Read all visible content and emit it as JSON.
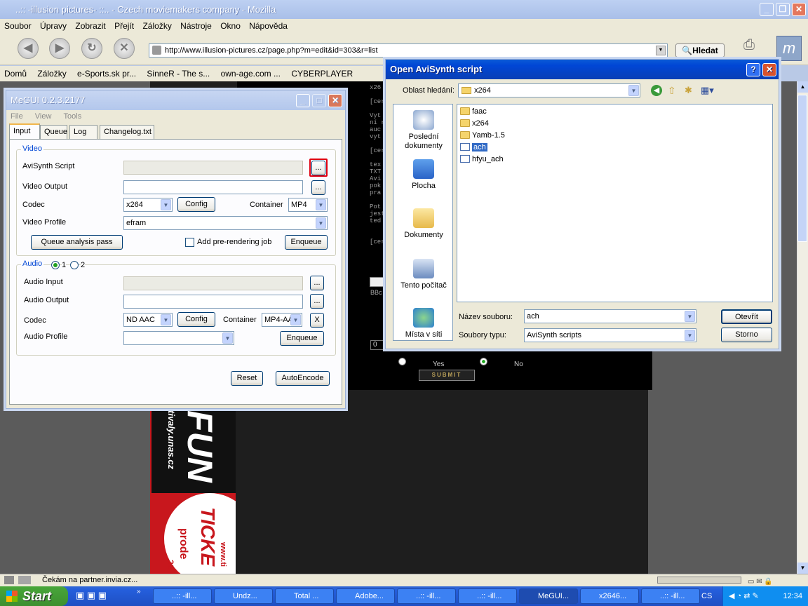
{
  "browser": {
    "title": "..:: -illusion pictures- ::.. - Czech moviemakers company - Mozilla",
    "menu": [
      "Soubor",
      "Úpravy",
      "Zobrazit",
      "Přejít",
      "Záložky",
      "Nástroje",
      "Okno",
      "Nápověda"
    ],
    "url": "http://www.illusion-pictures.cz/page.php?m=edit&id=303&r=list",
    "search_label": "Hledat",
    "bookmarks": [
      "Domů",
      "Záložky",
      "e-Sports.sk pr...",
      "SinneR - The s...",
      "own-age.com ...",
      "CYBERPLAYER"
    ],
    "status": "Čekám na partner.invia.cz...",
    "page_yes": "Yes",
    "page_no": "No",
    "page_submit": "SUBMIT",
    "terminal_lines": [
      "x26",
      "",
      "[cer",
      "",
      "Vyt",
      "ní r",
      "auc",
      "vyt",
      "",
      "[cer",
      "",
      "tex",
      "TXT",
      "Avi",
      "pok",
      "pra",
      "",
      "Pot",
      "jest",
      "ted",
      "",
      "",
      "[cer"
    ],
    "banner_text": "FUN",
    "banner_url": "tivaly.unas.cz",
    "banner_ticket": "TICKE",
    "banner_prod": "prode",
    "banner_www": "www.ti",
    "banner_num": "22",
    "page_zero": "0"
  },
  "megui": {
    "title": "MeGUI 0.2.3.2177",
    "menu": [
      "File",
      "View",
      "Tools"
    ],
    "tabs": [
      "Input",
      "Queue",
      "Log",
      "Changelog.txt"
    ],
    "video": {
      "group": "Video",
      "avisynth_label": "AviSynth Script",
      "avisynth_value": "",
      "output_label": "Video Output",
      "output_value": "",
      "codec_label": "Codec",
      "codec_value": "x264",
      "config_label": "Config",
      "container_label": "Container",
      "container_value": "MP4",
      "profile_label": "Video Profile",
      "profile_value": "efram",
      "queue_analysis_label": "Queue analysis pass",
      "prerender_label": "Add pre-rendering job",
      "enqueue_label": "Enqueue",
      "browse": "..."
    },
    "audio": {
      "group": "Audio",
      "radio1": "1",
      "radio2": "2",
      "input_label": "Audio Input",
      "output_label": "Audio Output",
      "codec_label": "Codec",
      "codec_value": "ND AAC",
      "config_label": "Config",
      "container_label": "Container",
      "container_value": "MP4-AA",
      "clear_label": "X",
      "profile_label": "Audio Profile",
      "profile_value": "",
      "enqueue_label": "Enqueue"
    },
    "reset_label": "Reset",
    "autoencode_label": "AutoEncode"
  },
  "dialog": {
    "title": "Open AviSynth script",
    "lookin_label": "Oblast hledání:",
    "lookin_value": "x264",
    "places": [
      "Poslední dokumenty",
      "Plocha",
      "Dokumenty",
      "Tento počítač",
      "Místa v síti"
    ],
    "files": [
      {
        "name": "faac",
        "type": "folder"
      },
      {
        "name": "x264",
        "type": "folder"
      },
      {
        "name": "Yamb-1.5",
        "type": "folder"
      },
      {
        "name": "ach",
        "type": "avs",
        "selected": true
      },
      {
        "name": "hfyu_ach",
        "type": "avs"
      }
    ],
    "filename_label": "Název souboru:",
    "filename_value": "ach",
    "filetype_label": "Soubory typu:",
    "filetype_value": "AviSynth scripts",
    "open_label": "Otevřít",
    "cancel_label": "Storno"
  },
  "taskbar": {
    "start": "Start",
    "tasks": [
      "..:: -ill...",
      "Undz...",
      "Total ...",
      "Adobe...",
      "..:: -ill...",
      "..:: -ill...",
      "MeGUI...",
      "x2646...",
      "..:: -ill..."
    ],
    "lang": "CS",
    "clock": "12:34"
  },
  "colors": {
    "xp_blue": "#0046d5",
    "accent_tab": "#f1b64b",
    "highlight": "#316ac5",
    "banner_red": "#c8171d"
  }
}
